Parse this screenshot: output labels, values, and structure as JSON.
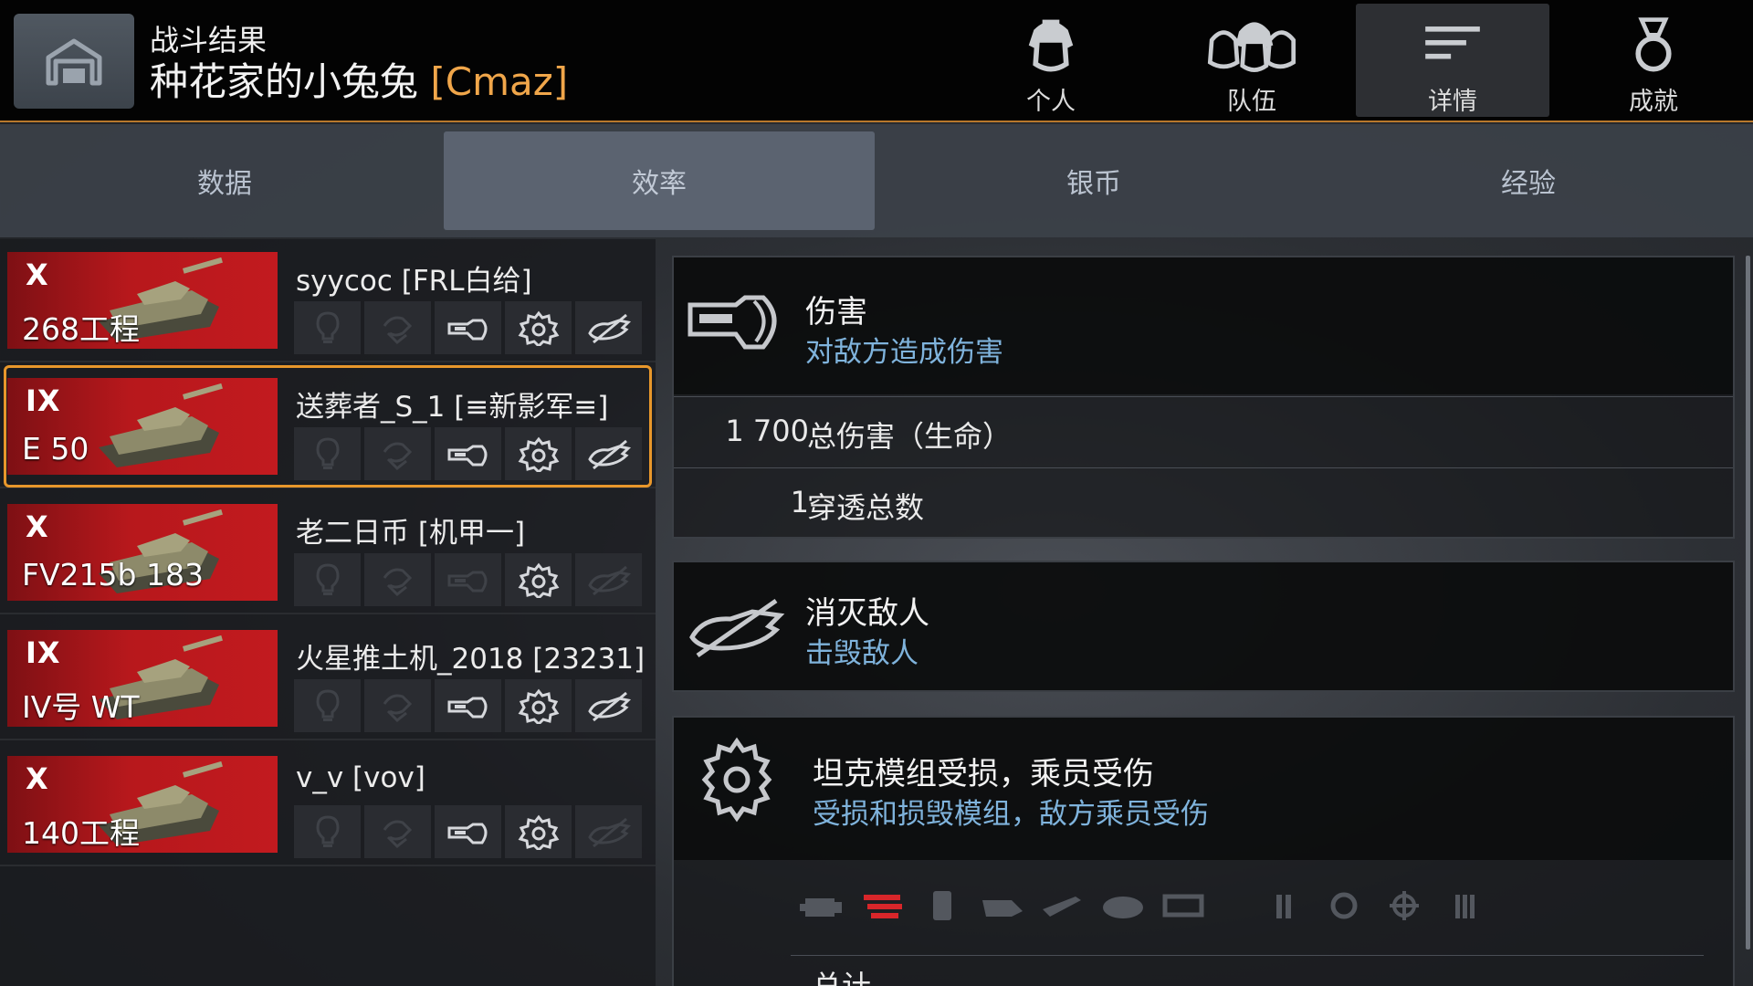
{
  "header": {
    "subtitle": "战斗结果",
    "player_name": "种花家的小兔兔",
    "player_clan": "[Cmaz]"
  },
  "top_tabs": [
    {
      "label": "个人",
      "icon": "helmet-icon",
      "active": false
    },
    {
      "label": "队伍",
      "icon": "team-icon",
      "active": false
    },
    {
      "label": "详情",
      "icon": "details-icon",
      "active": true
    },
    {
      "label": "成就",
      "icon": "medal-icon",
      "active": false
    }
  ],
  "sub_tabs": [
    {
      "label": "数据",
      "active": false
    },
    {
      "label": "效率",
      "active": true
    },
    {
      "label": "银币",
      "active": false
    },
    {
      "label": "经验",
      "active": false
    }
  ],
  "players": [
    {
      "tier": "X",
      "tank": "268工程",
      "name": "syycoc [FRL白给]",
      "selected": false,
      "icons": {
        "spot": false,
        "assist": false,
        "damage": true,
        "modules": true,
        "kill": true
      }
    },
    {
      "tier": "IX",
      "tank": "E 50",
      "name": "送葬者_S_1 [≡新影军≡]",
      "selected": true,
      "icons": {
        "spot": false,
        "assist": false,
        "damage": true,
        "modules": true,
        "kill": true
      }
    },
    {
      "tier": "X",
      "tank": "FV215b 183",
      "name": "老二日币 [机甲一]",
      "selected": false,
      "icons": {
        "spot": false,
        "assist": false,
        "damage": false,
        "modules": true,
        "kill": false
      }
    },
    {
      "tier": "IX",
      "tank": "IV号 WT",
      "name": "火星推土机_2018 [23231]",
      "selected": false,
      "icons": {
        "spot": false,
        "assist": false,
        "damage": true,
        "modules": true,
        "kill": true
      }
    },
    {
      "tier": "X",
      "tank": "140工程",
      "name": "v_v [vov]",
      "selected": false,
      "icons": {
        "spot": false,
        "assist": false,
        "damage": true,
        "modules": true,
        "kill": false
      }
    }
  ],
  "details": {
    "damage": {
      "title": "伤害",
      "subtitle": "对敌方造成伤害",
      "rows": [
        {
          "value": "1 700",
          "label": "总伤害（生命）"
        },
        {
          "value": "1",
          "label": "穿透总数"
        }
      ]
    },
    "kills": {
      "title": "消灭敌人",
      "subtitle": "击毁敌人"
    },
    "modules": {
      "title": "坦克模组受损，乘员受伤",
      "subtitle": "受损和损毁模组，敌方乘员受伤",
      "partial_row_label": "总计"
    }
  },
  "colors": {
    "accent_orange": "#e8972b",
    "clan_orange": "#f0a64a",
    "subtitle_blue": "#7fb3dc",
    "tank_red": "#c21a1f",
    "module_hit_red": "#d8262a"
  }
}
